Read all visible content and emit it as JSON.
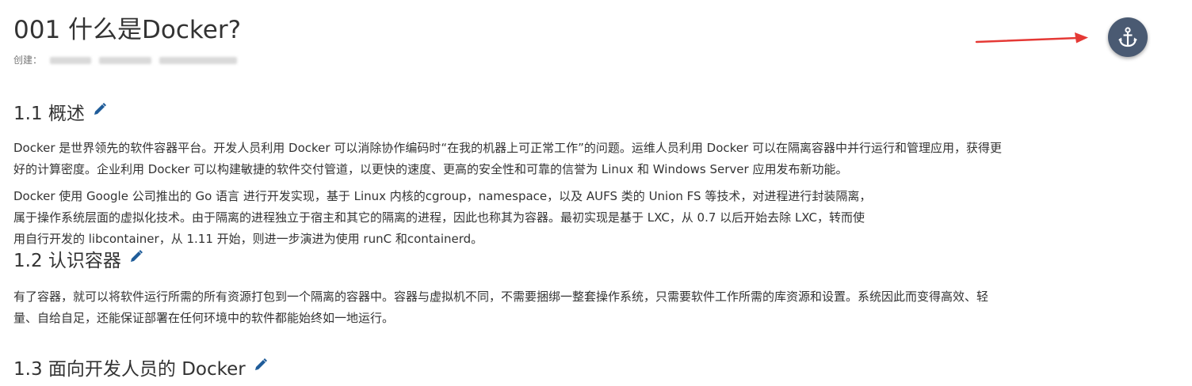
{
  "document": {
    "title": "001 什么是Docker?",
    "meta_label": "创建："
  },
  "anchor_button": {
    "icon": "anchor-icon",
    "color": "#4a5a72"
  },
  "annotation_arrow": {
    "color": "#e53935"
  },
  "sections": [
    {
      "heading": "1.1 概述",
      "paragraphs": [
        {
          "lines": [
            "Docker 是世界领先的软件容器平台。开发人员利用 Docker 可以消除协作编码时“在我的机器上可正常工作”的问题。运维人员利用 Docker 可以在隔离容器中并行运行和管理应用，获得更",
            "好的计算密度。企业利用 Docker 可以构建敏捷的软件交付管道，以更快的速度、更高的安全性和可靠的信誉为 Linux 和 Windows Server 应用发布新功能。"
          ]
        },
        {
          "lines": [
            "Docker 使用 Google 公司推出的 Go 语言 进行开发实现，基于 Linux 内核的cgroup，namespace，以及 AUFS 类的 Union FS 等技术，对进程进行封装隔离，",
            "属于操作系统层面的虚拟化技术。由于隔离的进程独立于宿主和其它的隔离的进程，因此也称其为容器。最初实现是基于 LXC，从 0.7 以后开始去除 LXC，转而使",
            "用自行开发的 libcontainer，从 1.11 开始，则进一步演进为使用 runC 和containerd。"
          ]
        }
      ]
    },
    {
      "heading": "1.2 认识容器",
      "paragraphs": [
        {
          "lines": [
            "有了容器，就可以将软件运行所需的所有资源打包到一个隔离的容器中。容器与虚拟机不同，不需要捆绑一整套操作系统，只需要软件工作所需的库资源和设置。系统因此而变得高效、轻",
            "量、自给自足，还能保证部署在任何环境中的软件都能始终如一地运行。"
          ]
        }
      ]
    },
    {
      "heading": "1.3 面向开发人员的 Docker",
      "paragraphs": []
    }
  ],
  "edit_icon": {
    "name": "pencil-icon",
    "color": "#1f5c99"
  }
}
